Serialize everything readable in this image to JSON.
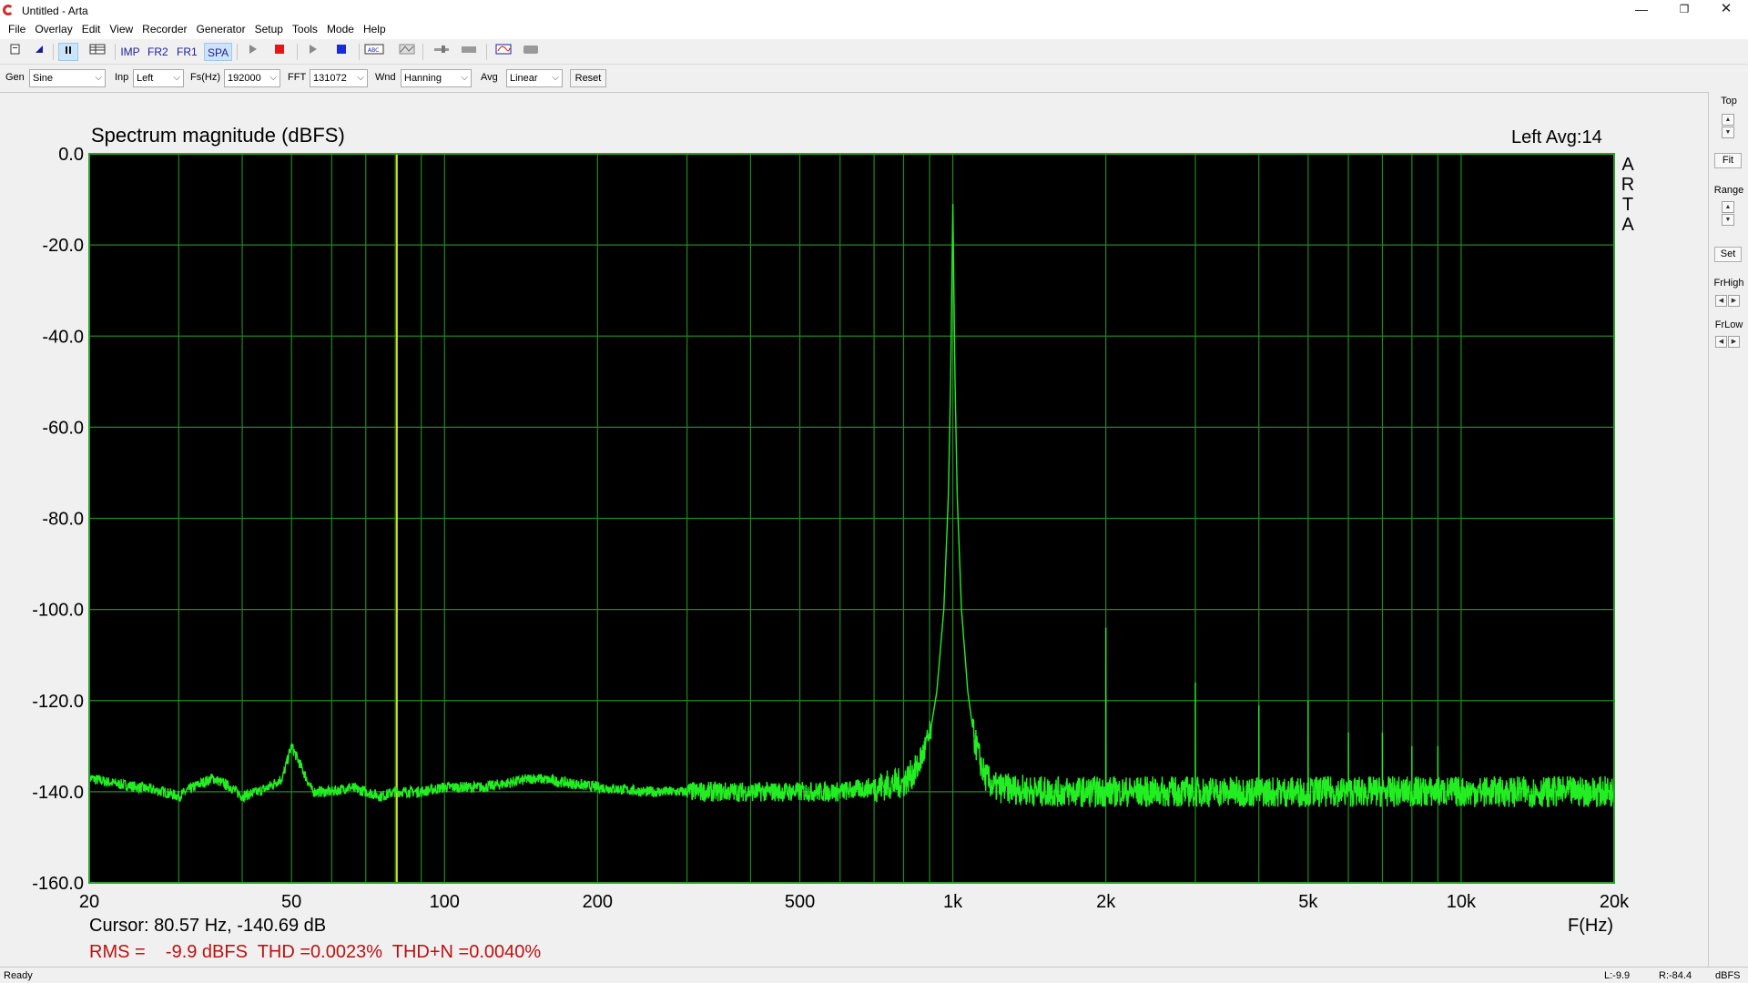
{
  "window": {
    "title": "Untitled - Arta",
    "minimize": "—",
    "maximize": "❐",
    "close": "✕"
  },
  "menu": [
    "File",
    "Overlay",
    "Edit",
    "View",
    "Recorder",
    "Generator",
    "Setup",
    "Tools",
    "Mode",
    "Help"
  ],
  "toolbar": {
    "imp": "IMP",
    "fr2": "FR2",
    "fr1": "FR1",
    "spa": "SPA",
    "icons": [
      "new-file-icon",
      "open-icon",
      "pause-icon",
      "spreadsheet-icon",
      "play-icon",
      "stop-icon",
      "play-alt-icon",
      "stop-alt-icon",
      "text-format-icon",
      "scope-icon",
      "slider-icon",
      "bar-icon",
      "monitor-icon",
      "gray-icon"
    ]
  },
  "controls": {
    "gen_label": "Gen",
    "gen_value": "Sine",
    "inp_label": "Inp",
    "inp_value": "Left",
    "fs_label": "Fs(Hz)",
    "fs_value": "192000",
    "fft_label": "FFT",
    "fft_value": "131072",
    "wnd_label": "Wnd",
    "wnd_value": "Hanning",
    "avg_label": "Avg",
    "avg_value": "Linear",
    "reset": "Reset"
  },
  "graph": {
    "channel": "Left  Avg:14",
    "side_label": [
      "A",
      "R",
      "T",
      "A"
    ],
    "cursor": "Cursor: 80.57 Hz, -140.69 dB",
    "fhz": "F(Hz)",
    "rms": "RMS =    -9.9 dBFS  THD =0.0023%  THD+N =0.0040%"
  },
  "chart_data": {
    "type": "line",
    "title": "Spectrum magnitude (dBFS)",
    "xlabel": "F(Hz)",
    "ylabel": "",
    "xscale": "log",
    "xlim": [
      20,
      20000
    ],
    "ylim": [
      -160,
      0
    ],
    "x_ticks": [
      20,
      50,
      100,
      200,
      500,
      1000,
      2000,
      5000,
      10000,
      20000
    ],
    "x_tick_labels": [
      "20",
      "50",
      "100",
      "200",
      "500",
      "1k",
      "2k",
      "5k",
      "10k",
      "20k"
    ],
    "y_ticks": [
      0,
      -20,
      -40,
      -60,
      -80,
      -100,
      -120,
      -140,
      -160
    ],
    "y_tick_labels": [
      "0.0",
      "-20.0",
      "-40.0",
      "-60.0",
      "-80.0",
      "-100.0",
      "-120.0",
      "-140.0",
      "-160.0"
    ],
    "grid": true,
    "background": "#000000",
    "grid_color": "#1f8a1f",
    "trace_color": "#22ee22",
    "cursor_color": "#d8d820",
    "cursor_x": 80.57,
    "noise_floor_db": -140,
    "series": [
      {
        "points": [
          [
            20,
            -137
          ],
          [
            22,
            -138
          ],
          [
            25,
            -139
          ],
          [
            28,
            -140
          ],
          [
            30,
            -141
          ],
          [
            32,
            -139
          ],
          [
            35,
            -137
          ],
          [
            38,
            -139
          ],
          [
            40,
            -141
          ],
          [
            43,
            -140
          ],
          [
            45,
            -139
          ],
          [
            48,
            -137
          ],
          [
            50,
            -130
          ],
          [
            52,
            -134
          ],
          [
            55,
            -140
          ],
          [
            60,
            -140
          ],
          [
            65,
            -139
          ],
          [
            70,
            -140
          ],
          [
            75,
            -141
          ],
          [
            80,
            -140
          ],
          [
            90,
            -140
          ],
          [
            100,
            -139
          ],
          [
            120,
            -139
          ],
          [
            150,
            -137
          ],
          [
            200,
            -139
          ],
          [
            250,
            -140
          ],
          [
            300,
            -140
          ],
          [
            400,
            -140
          ],
          [
            500,
            -140
          ],
          [
            600,
            -140
          ],
          [
            700,
            -139
          ],
          [
            800,
            -138
          ],
          [
            850,
            -135
          ],
          [
            900,
            -128
          ],
          [
            930,
            -118
          ],
          [
            960,
            -100
          ],
          [
            980,
            -75
          ],
          [
            990,
            -50
          ],
          [
            1000,
            -11
          ],
          [
            1010,
            -50
          ],
          [
            1020,
            -75
          ],
          [
            1040,
            -100
          ],
          [
            1070,
            -118
          ],
          [
            1100,
            -128
          ],
          [
            1150,
            -136
          ],
          [
            1200,
            -139
          ],
          [
            1500,
            -140
          ],
          [
            1999,
            -140
          ],
          [
            2000,
            -104
          ],
          [
            2001,
            -140
          ],
          [
            2999,
            -140
          ],
          [
            3000,
            -116
          ],
          [
            3001,
            -140
          ],
          [
            3999,
            -140
          ],
          [
            4000,
            -121
          ],
          [
            4001,
            -140
          ],
          [
            4999,
            -140
          ],
          [
            5000,
            -120
          ],
          [
            5001,
            -140
          ],
          [
            5999,
            -140
          ],
          [
            6000,
            -127
          ],
          [
            6001,
            -140
          ],
          [
            6999,
            -140
          ],
          [
            7000,
            -127
          ],
          [
            7001,
            -140
          ],
          [
            7999,
            -140
          ],
          [
            8000,
            -130
          ],
          [
            8001,
            -140
          ],
          [
            8999,
            -140
          ],
          [
            9000,
            -130
          ],
          [
            9001,
            -140
          ],
          [
            10000,
            -140
          ],
          [
            12000,
            -140
          ],
          [
            15000,
            -140
          ],
          [
            18000,
            -140
          ],
          [
            20000,
            -140
          ]
        ]
      }
    ]
  },
  "right_panel": {
    "top": "Top",
    "fit": "Fit",
    "range": "Range",
    "set": "Set",
    "frhigh": "FrHigh",
    "frlow": "FrLow",
    "up": "▲",
    "down": "▼",
    "left": "◀",
    "right": "▶"
  },
  "status": {
    "ready": "Ready",
    "l_level": "L:-9.9",
    "r_level": "R:-84.4",
    "unit": "dBFS"
  }
}
